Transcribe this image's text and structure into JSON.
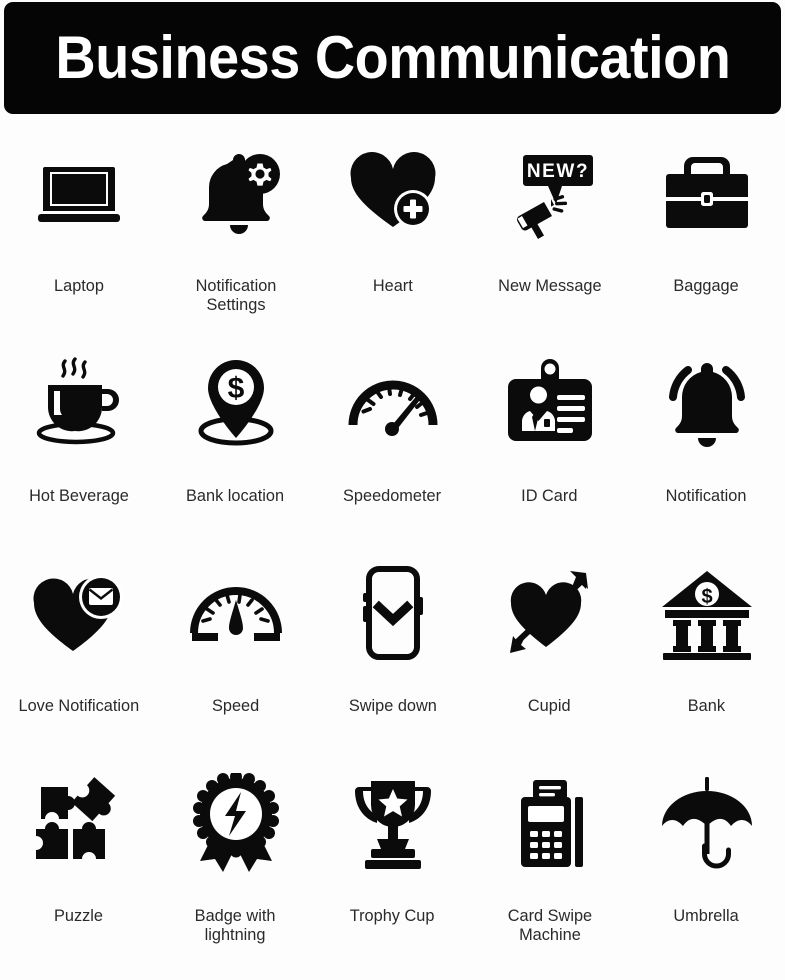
{
  "header": {
    "title": "Business Communication",
    "background_color": "#050505",
    "text_color": "#ffffff"
  },
  "page": {
    "background_color": "#fdfdfd",
    "icon_color": "#0b0b0b",
    "label_color": "#2a2a2a",
    "columns": 5,
    "rows": 4
  },
  "icons": [
    {
      "id": "laptop",
      "label": "Laptop",
      "icon_name": "laptop-icon"
    },
    {
      "id": "notification-settings",
      "label": "Notification Settings",
      "icon_name": "bell-gear-icon"
    },
    {
      "id": "heart",
      "label": "Heart",
      "icon_name": "heart-plus-icon"
    },
    {
      "id": "new-message",
      "label": "New Message",
      "icon_name": "megaphone-new-bubble-icon",
      "bubble_text": "NEW?"
    },
    {
      "id": "baggage",
      "label": "Baggage",
      "icon_name": "briefcase-icon"
    },
    {
      "id": "hot-beverage",
      "label": "Hot Beverage",
      "icon_name": "coffee-cup-icon"
    },
    {
      "id": "bank-location",
      "label": "Bank location",
      "icon_name": "map-pin-dollar-icon"
    },
    {
      "id": "speedometer",
      "label": "Speedometer",
      "icon_name": "speedometer-icon"
    },
    {
      "id": "id-card",
      "label": "ID Card",
      "icon_name": "id-card-icon"
    },
    {
      "id": "notification",
      "label": "Notification",
      "icon_name": "bell-ringing-icon"
    },
    {
      "id": "love-notification",
      "label": "Love Notification",
      "icon_name": "heart-envelope-icon"
    },
    {
      "id": "speed",
      "label": "Speed",
      "icon_name": "speed-gauge-icon"
    },
    {
      "id": "swipe-down",
      "label": "Swipe down",
      "icon_name": "phone-chevron-down-icon"
    },
    {
      "id": "cupid",
      "label": "Cupid",
      "icon_name": "heart-arrow-icon"
    },
    {
      "id": "bank",
      "label": "Bank",
      "icon_name": "bank-building-dollar-icon"
    },
    {
      "id": "puzzle",
      "label": "Puzzle",
      "icon_name": "puzzle-pieces-icon"
    },
    {
      "id": "badge-with-lightning",
      "label": "Badge with\nlightning",
      "icon_name": "award-badge-lightning-icon"
    },
    {
      "id": "trophy-cup",
      "label": "Trophy Cup",
      "icon_name": "trophy-star-icon"
    },
    {
      "id": "card-swipe-machine",
      "label": "Card Swipe\nMachine",
      "icon_name": "pos-terminal-icon"
    },
    {
      "id": "umbrella",
      "label": "Umbrella",
      "icon_name": "umbrella-icon"
    }
  ]
}
